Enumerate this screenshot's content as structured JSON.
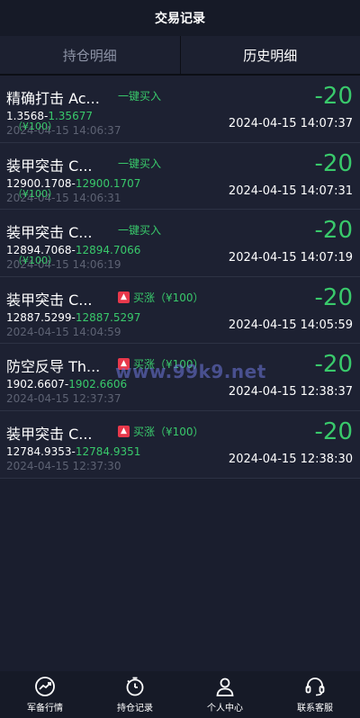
{
  "header": {
    "title": "交易记录"
  },
  "tabs": [
    {
      "label": "持仓明细",
      "active": false
    },
    {
      "label": "历史明细",
      "active": true
    }
  ],
  "records": [
    {
      "name": "精确打击 Ac...",
      "tag": "一键买入",
      "tag_type": "quick_buy",
      "amount": "-20",
      "open_price": "1.3568",
      "close_price": "1.35677",
      "stake": "（¥100）",
      "open_time": "2024-04-15 14:06:37",
      "close_time": "2024-04-15 14:07:37"
    },
    {
      "name": "装甲突击 C...",
      "tag": "一键买入",
      "tag_type": "quick_buy",
      "amount": "-20",
      "open_price": "12900.1708",
      "close_price": "12900.1707",
      "stake": "（¥100）",
      "open_time": "2024-04-15 14:06:31",
      "close_time": "2024-04-15 14:07:31"
    },
    {
      "name": "装甲突击 C...",
      "tag": "一键买入",
      "tag_type": "quick_buy",
      "amount": "-20",
      "open_price": "12894.7068",
      "close_price": "12894.7066",
      "stake": "（¥100）",
      "open_time": "2024-04-15 14:06:19",
      "close_time": "2024-04-15 14:07:19"
    },
    {
      "name": "装甲突击 C...",
      "tag": "买涨（¥100）",
      "tag_type": "buy_up",
      "amount": "-20",
      "open_price": "12887.5299",
      "close_price": "12887.5297",
      "stake": "",
      "open_time": "2024-04-15 14:04:59",
      "close_time": "2024-04-15 14:05:59"
    },
    {
      "name": "防空反导 Th...",
      "tag": "买涨（¥100）",
      "tag_type": "buy_up",
      "amount": "-20",
      "open_price": "1902.6607",
      "close_price": "1902.6606",
      "stake": "",
      "open_time": "2024-04-15 12:37:37",
      "close_time": "2024-04-15 12:38:37"
    },
    {
      "name": "装甲突击 C...",
      "tag": "买涨（¥100）",
      "tag_type": "buy_up",
      "amount": "-20",
      "open_price": "12784.9353",
      "close_price": "12784.9351",
      "stake": "",
      "open_time": "2024-04-15 12:37:30",
      "close_time": "2024-04-15 12:38:30"
    }
  ],
  "watermark": "www.99k9.net",
  "bottom_nav": [
    {
      "label": "军备行情",
      "icon": "market-trend-icon"
    },
    {
      "label": "持仓记录",
      "icon": "stopwatch-icon"
    },
    {
      "label": "个人中心",
      "icon": "user-icon"
    },
    {
      "label": "联系客服",
      "icon": "headset-icon"
    }
  ],
  "colors": {
    "background": "#1a1e2e",
    "profit_green": "#39c96b",
    "buy_up_red": "#e8384b",
    "watermark": "#6e78dc"
  }
}
